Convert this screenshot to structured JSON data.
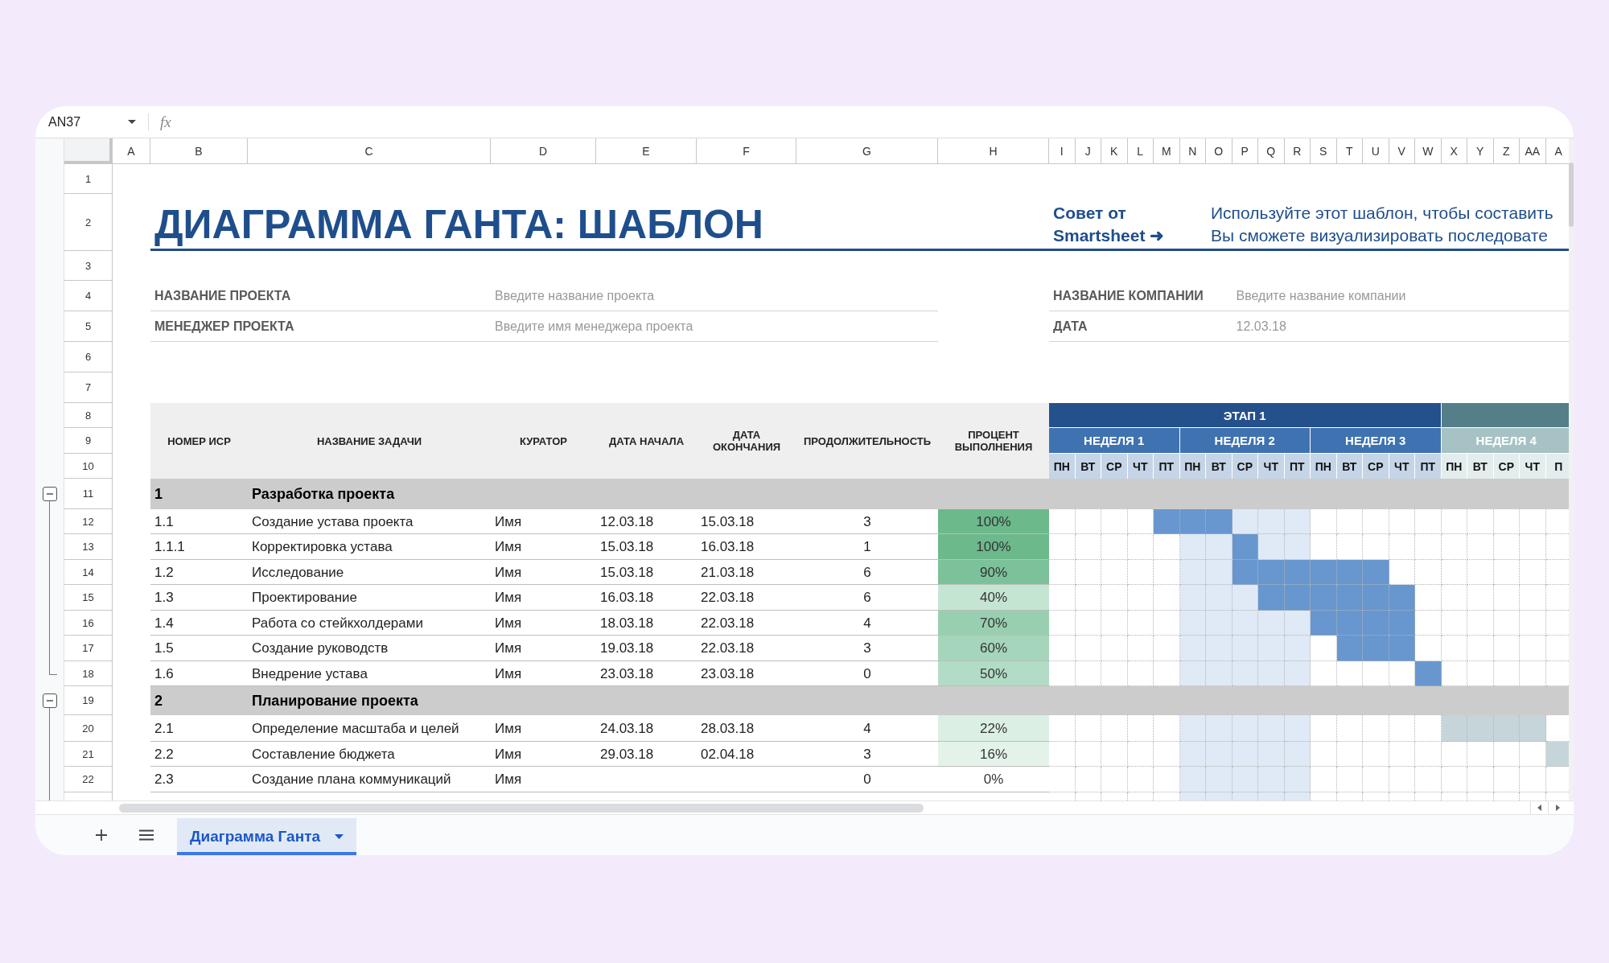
{
  "name_box": {
    "value": "AN37"
  },
  "formula_bar": {
    "icon": "fx"
  },
  "columns": [
    "A",
    "B",
    "C",
    "D",
    "E",
    "F",
    "G",
    "H",
    "I",
    "J",
    "K",
    "L",
    "M",
    "N",
    "O",
    "P",
    "Q",
    "R",
    "S",
    "T",
    "U",
    "V",
    "W",
    "X",
    "Y",
    "Z",
    "AA",
    "A"
  ],
  "row_numbers": [
    "1",
    "2",
    "3",
    "4",
    "5",
    "6",
    "7",
    "8",
    "9",
    "10",
    "11",
    "12",
    "13",
    "14",
    "15",
    "16",
    "17",
    "18",
    "19",
    "20",
    "21",
    "22"
  ],
  "title": "ДИАГРАММА ГАНТА: ШАБЛОН",
  "tip": {
    "label_lines": [
      "Совет от",
      "Smartsheet ➜"
    ],
    "text_lines": [
      "Используйте этот шаблон, чтобы составить",
      "Вы сможете визуализировать последовате"
    ]
  },
  "project_fields": [
    {
      "label": "НАЗВАНИЕ ПРОЕКТА",
      "value": "Введите название проекта"
    },
    {
      "label": "МЕНЕДЖЕР ПРОЕКТА",
      "value": "Введите имя менеджера проекта"
    }
  ],
  "company_fields": [
    {
      "label": "НАЗВАНИЕ КОМПАНИИ",
      "value": "Введите название компании"
    },
    {
      "label": "ДАТА",
      "value": "12.03.18"
    }
  ],
  "table": {
    "columns": [
      "НОМЕР ИСР",
      "НАЗВАНИЕ ЗАДАЧИ",
      "КУРАТОР",
      "ДАТА НАЧАЛА",
      "ДАТА ОКОНЧАНИЯ",
      "ПРОДОЛЖИТЕЛЬНОСТЬ",
      "ПРОЦЕНТ ВЫПОЛНЕНИЯ"
    ]
  },
  "timeline": {
    "stages": [
      {
        "label": "ЭТАП 1",
        "color": "#24508c",
        "weeks": [
          {
            "label": "НЕДЕЛЯ 1",
            "color": "#3f72b0",
            "highlighted": false,
            "days": [
              "ПН",
              "ВТ",
              "СР",
              "ЧТ",
              "ПТ"
            ]
          },
          {
            "label": "НЕДЕЛЯ 2",
            "color": "#3f72b0",
            "highlighted": true,
            "days": [
              "ПН",
              "ВТ",
              "СР",
              "ЧТ",
              "ПТ"
            ]
          },
          {
            "label": "НЕДЕЛЯ 3",
            "color": "#3f72b0",
            "highlighted": false,
            "days": [
              "ПН",
              "ВТ",
              "СР",
              "ЧТ",
              "ПТ"
            ]
          }
        ]
      },
      {
        "color": "#547f88",
        "weeks": [
          {
            "label": "НЕДЕЛЯ 4",
            "color": "#a6c2c4",
            "highlighted": false,
            "days": [
              "ПН",
              "ВТ",
              "СР",
              "ЧТ",
              "П"
            ]
          }
        ]
      }
    ]
  },
  "phases": [
    {
      "number": "1",
      "name": "Разработка проекта",
      "expanded": true,
      "color": "#6897cf",
      "tasks": [
        {
          "wbs": "1.1",
          "name": "Создание устава проекта",
          "owner": "Имя",
          "start": "12.03.18",
          "end": "15.03.18",
          "duration": "3",
          "percent": "100%",
          "color": "#6cb98c",
          "timeline": [
            false,
            false,
            false,
            false,
            true,
            true,
            true,
            false,
            false,
            false,
            false,
            false,
            false,
            false,
            false,
            false,
            false,
            false,
            false,
            false
          ]
        },
        {
          "wbs": "1.1.1",
          "name": "Корректировка устава",
          "owner": "Имя",
          "start": "15.03.18",
          "end": "16.03.18",
          "duration": "1",
          "percent": "100%",
          "color": "#6cb98c",
          "timeline": [
            false,
            false,
            false,
            false,
            false,
            false,
            false,
            true,
            false,
            false,
            false,
            false,
            false,
            false,
            false,
            false,
            false,
            false,
            false,
            false
          ]
        },
        {
          "wbs": "1.2",
          "name": "Исследование",
          "owner": "Имя",
          "start": "15.03.18",
          "end": "21.03.18",
          "duration": "6",
          "percent": "90%",
          "color": "#7bc29a",
          "timeline": [
            false,
            false,
            false,
            false,
            false,
            false,
            false,
            true,
            true,
            true,
            true,
            true,
            true,
            false,
            false,
            false,
            false,
            false,
            false,
            false
          ]
        },
        {
          "wbs": "1.3",
          "name": "Проектирование",
          "owner": "Имя",
          "start": "16.03.18",
          "end": "22.03.18",
          "duration": "6",
          "percent": "40%",
          "color": "#c5e5d3",
          "timeline": [
            false,
            false,
            false,
            false,
            false,
            false,
            false,
            false,
            true,
            true,
            true,
            true,
            true,
            true,
            false,
            false,
            false,
            false,
            false,
            false
          ]
        },
        {
          "wbs": "1.4",
          "name": "Работа со стейкхолдерами",
          "owner": "Имя",
          "start": "18.03.18",
          "end": "22.03.18",
          "duration": "4",
          "percent": "70%",
          "color": "#98cfb1",
          "timeline": [
            false,
            false,
            false,
            false,
            false,
            false,
            false,
            false,
            false,
            false,
            true,
            true,
            true,
            true,
            false,
            false,
            false,
            false,
            false,
            false
          ]
        },
        {
          "wbs": "1.5",
          "name": "Создание руководств",
          "owner": "Имя",
          "start": "19.03.18",
          "end": "22.03.18",
          "duration": "3",
          "percent": "60%",
          "color": "#a5d5ba",
          "timeline": [
            false,
            false,
            false,
            false,
            false,
            false,
            false,
            false,
            false,
            false,
            false,
            true,
            true,
            true,
            false,
            false,
            false,
            false,
            false,
            false
          ]
        },
        {
          "wbs": "1.6",
          "name": "Внедрение устава",
          "owner": "Имя",
          "start": "23.03.18",
          "end": "23.03.18",
          "duration": "0",
          "percent": "50%",
          "color": "#b2dcc5",
          "timeline": [
            false,
            false,
            false,
            false,
            false,
            false,
            false,
            false,
            false,
            false,
            false,
            false,
            false,
            false,
            true,
            false,
            false,
            false,
            false,
            false
          ]
        }
      ]
    },
    {
      "number": "2",
      "name": "Планирование проекта",
      "expanded": true,
      "color": "#c6d5d9",
      "tasks": [
        {
          "wbs": "2.1",
          "name": "Определение масштаба и целей",
          "owner": "Имя",
          "start": "24.03.18",
          "end": "28.03.18",
          "duration": "4",
          "percent": "22%",
          "color": "#dcefe4",
          "timeline": [
            false,
            false,
            false,
            false,
            false,
            false,
            false,
            false,
            false,
            false,
            false,
            false,
            false,
            false,
            false,
            true,
            true,
            true,
            true,
            false
          ]
        },
        {
          "wbs": "2.2",
          "name": "Составление бюджета",
          "owner": "Имя",
          "start": "29.03.18",
          "end": "02.04.18",
          "duration": "3",
          "percent": "16%",
          "color": "#e4f3ea",
          "timeline": [
            false,
            false,
            false,
            false,
            false,
            false,
            false,
            false,
            false,
            false,
            false,
            false,
            false,
            false,
            false,
            false,
            false,
            false,
            false,
            true
          ]
        },
        {
          "wbs": "2.3",
          "name": "Создание плана коммуникаций",
          "owner": "Имя",
          "duration": "0",
          "percent": "0%",
          "color": "#ffffff",
          "timeline": [
            false,
            false,
            false,
            false,
            false,
            false,
            false,
            false,
            false,
            false,
            false,
            false,
            false,
            false,
            false,
            false,
            false,
            false,
            false,
            false
          ]
        }
      ]
    }
  ],
  "sheet_tabs": [
    {
      "label": "Диаграмма Ганта",
      "selected": true
    }
  ]
}
